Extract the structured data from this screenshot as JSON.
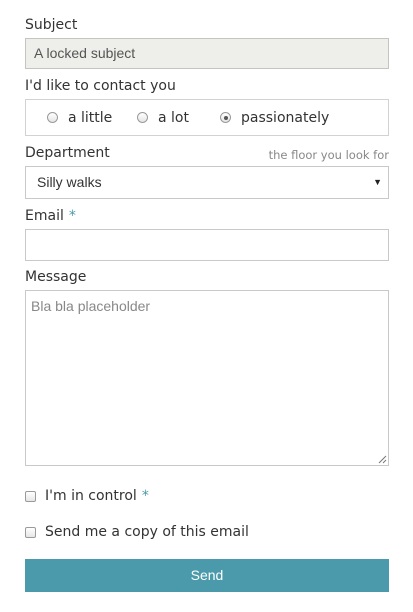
{
  "subject": {
    "label": "Subject",
    "value": "A locked subject"
  },
  "contact": {
    "label": "I'd like to contact you",
    "options": [
      {
        "label": "a little",
        "checked": false
      },
      {
        "label": "a lot",
        "checked": false
      },
      {
        "label": "passionately",
        "checked": true
      }
    ]
  },
  "department": {
    "label": "Department",
    "hint": "the floor you look for",
    "selected": "Silly walks",
    "arrow": "▼"
  },
  "email": {
    "label": "Email",
    "required_mark": "*",
    "value": ""
  },
  "message": {
    "label": "Message",
    "placeholder": "Bla bla placeholder"
  },
  "control": {
    "label": "I'm in control",
    "required_mark": "*",
    "checked": false
  },
  "copy": {
    "label": "Send me a copy of this email",
    "checked": false
  },
  "send_button": {
    "label": "Send"
  },
  "colors": {
    "accent": "#4b9aac",
    "locked_bg": "#eeeeea"
  }
}
